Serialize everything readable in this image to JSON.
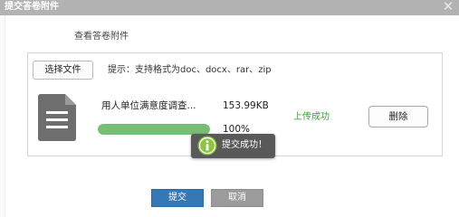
{
  "dialog": {
    "title": "提交答卷附件",
    "close_symbol": "✕"
  },
  "section": {
    "title": "查看答卷附件"
  },
  "upload": {
    "choose_button": "选择文件",
    "hint": "提示：支持格式为doc、docx、rar、zip"
  },
  "file": {
    "icon": "document-icon",
    "name": "用人单位满意度调查...",
    "size": "153.99KB",
    "progress_text": "100%",
    "progress_fraction": 1.0,
    "status": "上传成功",
    "delete_button": "删除"
  },
  "toast": {
    "icon": "info-icon",
    "message": "提交成功！"
  },
  "footer": {
    "submit_button": "提交",
    "cancel_button": "取消"
  },
  "colors": {
    "titlebar": "#b2b2b2",
    "progress_fill": "#76bd76",
    "status_success": "#3c9a3c",
    "submit_bg": "#3478b5",
    "cancel_bg": "#9b9b9b",
    "toast_bg": "#595959",
    "toast_icon": "#8cc63f"
  }
}
